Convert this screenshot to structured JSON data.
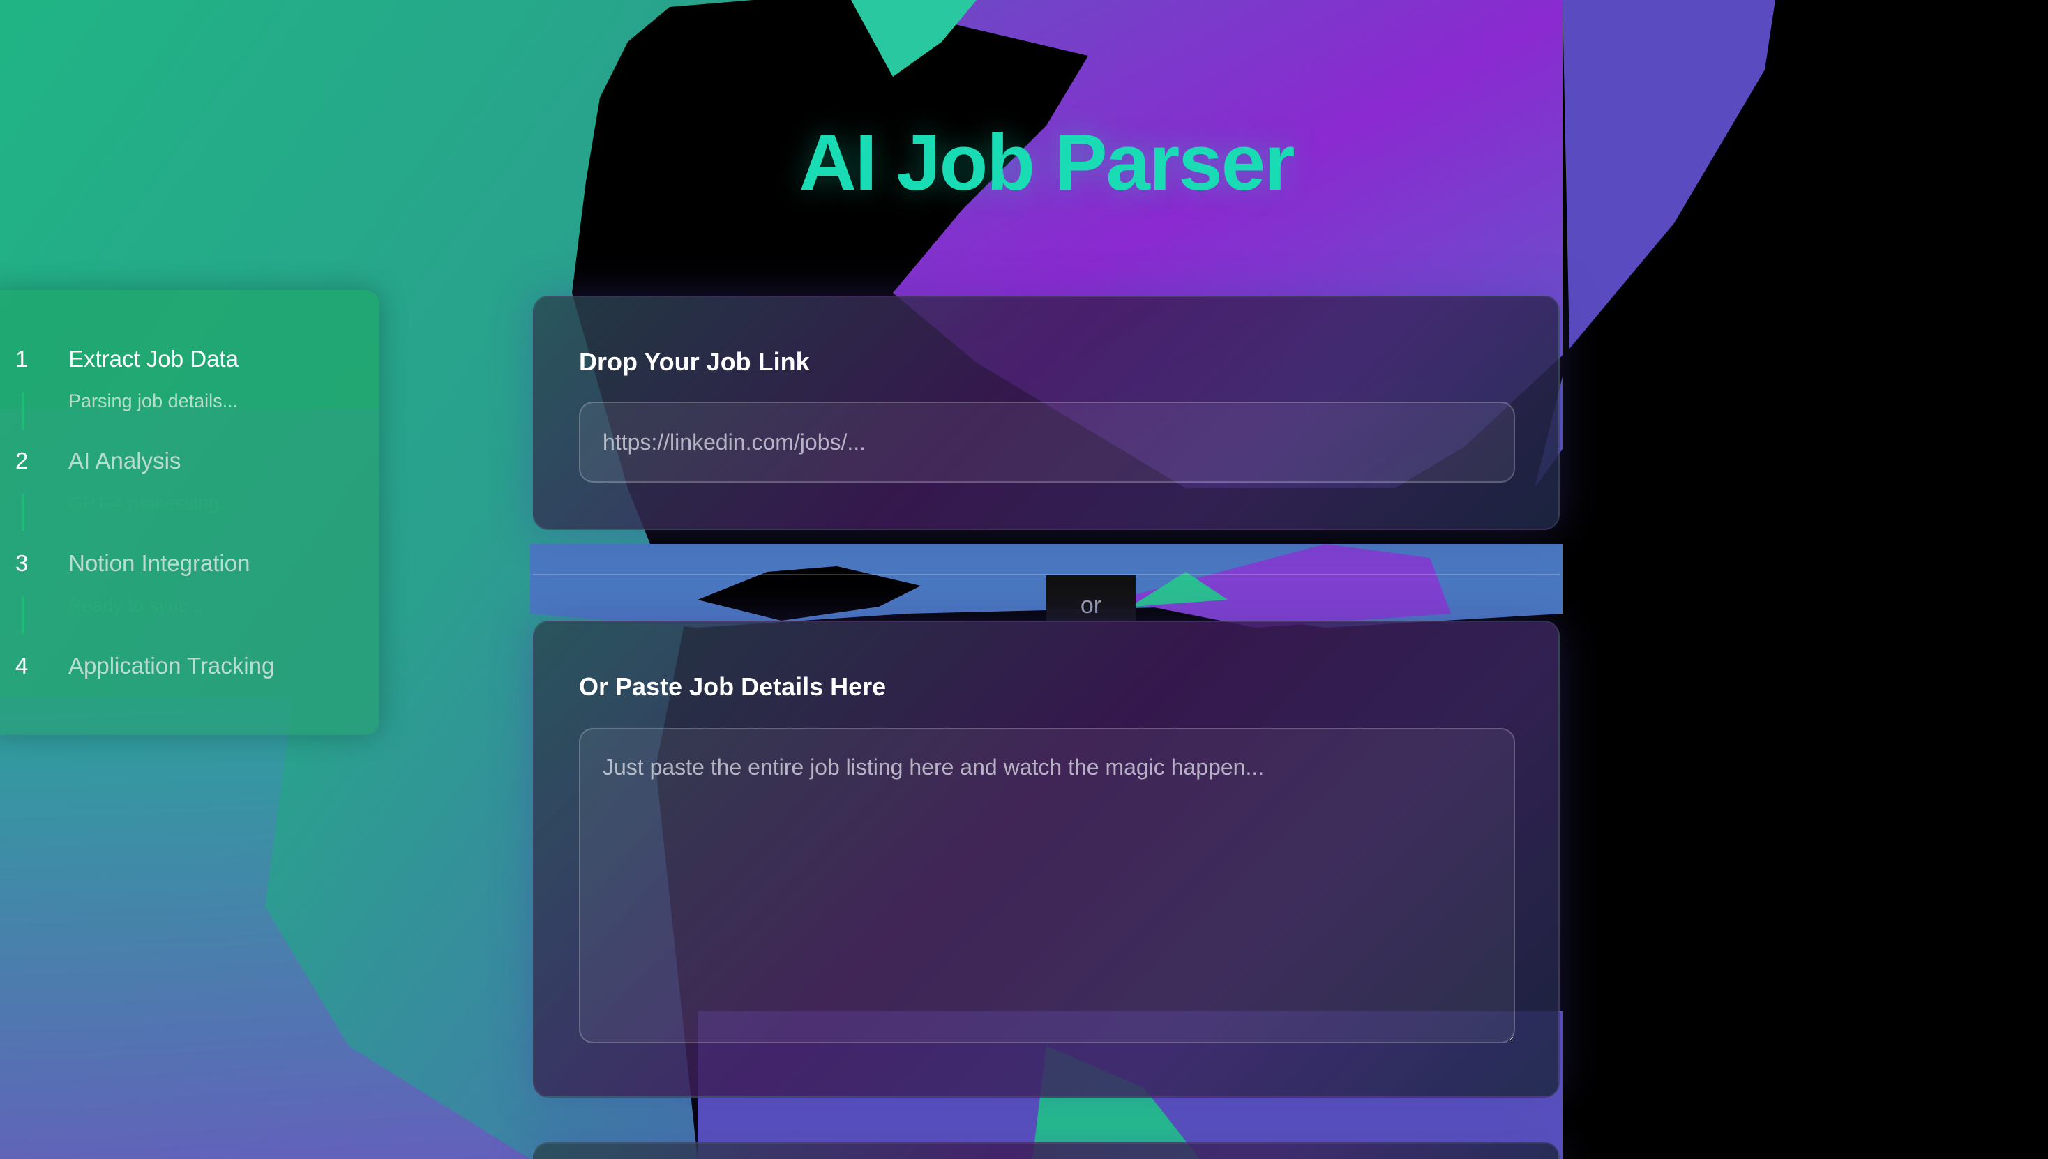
{
  "app": {
    "title": "AI Job Parser"
  },
  "steps": [
    {
      "number": "1",
      "label": "Extract Job Data",
      "status": "Parsing job details..."
    },
    {
      "number": "2",
      "label": "AI Analysis",
      "status": "GPT-4 processing..."
    },
    {
      "number": "3",
      "label": "Notion Integration",
      "status": "Ready to sync..."
    },
    {
      "number": "4",
      "label": "Application Tracking",
      "status": ""
    }
  ],
  "link_card": {
    "heading": "Drop Your Job Link",
    "placeholder": "https://linkedin.com/jobs/..."
  },
  "divider": {
    "label": "or"
  },
  "paste_card": {
    "heading": "Or Paste Job Details Here",
    "placeholder": "Just paste the entire job listing here and watch the magic happen..."
  },
  "colors": {
    "accent": "#19dcb4",
    "step_active": "#ffffff",
    "step_inactive": "#b8d8cc"
  }
}
